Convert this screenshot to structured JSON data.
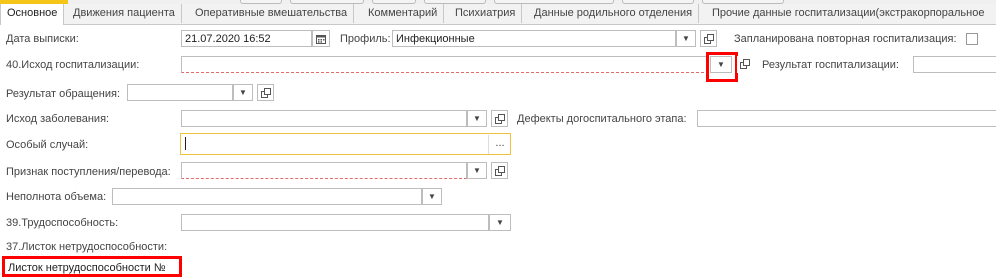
{
  "tabs": [
    {
      "label": "Основное"
    },
    {
      "label": "Движения пациента"
    },
    {
      "label": "Оперативные вмешательства"
    },
    {
      "label": "Комментарий"
    },
    {
      "label": "Психиатрия"
    },
    {
      "label": "Данные родильного отделения"
    },
    {
      "label": "Прочие данные госпитализации(экстракорпоральное"
    }
  ],
  "form": {
    "discharge_date_label": "Дата выписки:",
    "discharge_date_value": "21.07.2020 16:52",
    "profile_label": "Профиль:",
    "profile_value": "Инфекционные",
    "planned_rehosp_label": "Запланирована повторная госпитализация:",
    "outcome_label": "40.Исход госпитализации:",
    "outcome_value": "",
    "result_hosp_label": "Результат госпитализации:",
    "result_appeal_label": "Результат обращения:",
    "disease_outcome_label": "Исход заболевания:",
    "prehosp_defects_label": "Дефекты догоспитального этапа:",
    "special_case_label": "Особый случай:",
    "special_case_ellipsis": "...",
    "admission_sign_label": "Признак поступления/перевода:",
    "incomplete_volume_label": "Неполнота объема:",
    "work_capacity_label": "39.Трудоспособность:",
    "sick_leave_label": "37.Листок нетрудоспособности:",
    "sick_leave_no_label": "Листок нетрудоспособности №"
  }
}
